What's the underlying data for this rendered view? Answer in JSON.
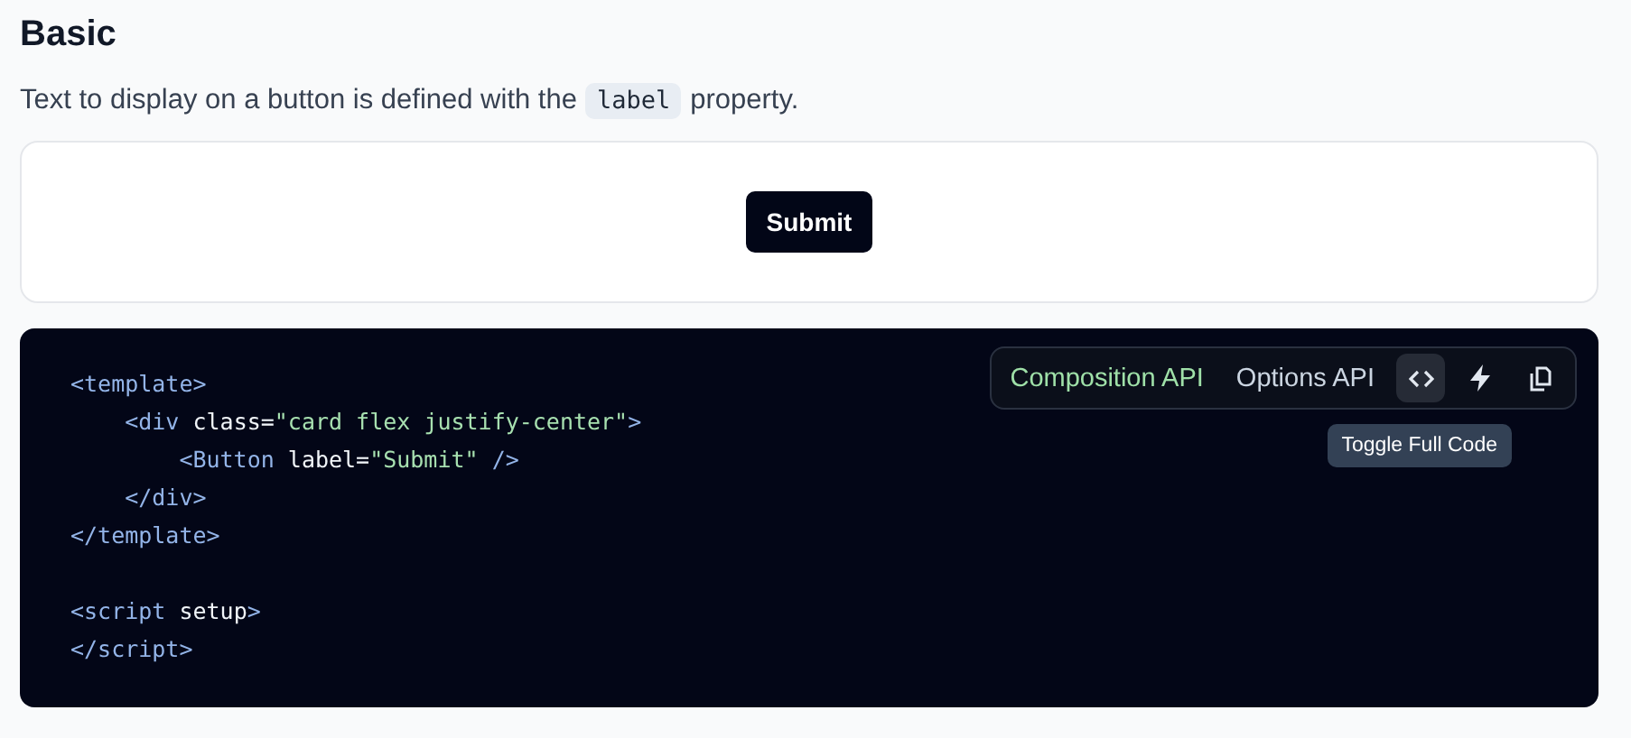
{
  "heading": "Basic",
  "description_parts": [
    {
      "kind": "text",
      "text": "Text to display on a button is defined with the"
    },
    {
      "kind": "code",
      "text": "label"
    },
    {
      "kind": "text",
      "text": "property."
    }
  ],
  "preview": {
    "button": {
      "label": "Submit"
    }
  },
  "toolbar": {
    "tabs": [
      {
        "label": "Composition API",
        "selected": true
      },
      {
        "label": "Options API",
        "selected": false
      }
    ],
    "actions": [
      {
        "kind": "code",
        "hovered": true
      },
      {
        "kind": "bolt",
        "hovered": false
      },
      {
        "kind": "copy",
        "hovered": false
      }
    ],
    "tooltip": "Toggle Full Code"
  },
  "code_lines": [
    {
      "kind": "code",
      "tokens": [
        {
          "kind": "tag",
          "text": "<template>"
        }
      ]
    },
    {
      "kind": "code",
      "tokens": [
        {
          "kind": "tag",
          "text": "    <div"
        },
        {
          "kind": "plain",
          "text": " class="
        },
        {
          "kind": "string",
          "text": "\"card flex justify-center\""
        },
        {
          "kind": "tag",
          "text": ">"
        }
      ]
    },
    {
      "kind": "code",
      "tokens": [
        {
          "kind": "tag",
          "text": "        <Button"
        },
        {
          "kind": "plain",
          "text": " label="
        },
        {
          "kind": "string",
          "text": "\"Submit\""
        },
        {
          "kind": "tag",
          "text": " />"
        }
      ]
    },
    {
      "kind": "code",
      "tokens": [
        {
          "kind": "tag",
          "text": "    </div>"
        }
      ]
    },
    {
      "kind": "code",
      "tokens": [
        {
          "kind": "tag",
          "text": "</template>"
        }
      ]
    },
    {
      "kind": "blank"
    },
    {
      "kind": "code",
      "tokens": [
        {
          "kind": "tag",
          "text": "<script"
        },
        {
          "kind": "plain",
          "text": " setup"
        },
        {
          "kind": "tag",
          "text": ">"
        }
      ]
    },
    {
      "kind": "code",
      "tokens": [
        {
          "kind": "tag",
          "text": "</script>"
        }
      ]
    }
  ]
}
